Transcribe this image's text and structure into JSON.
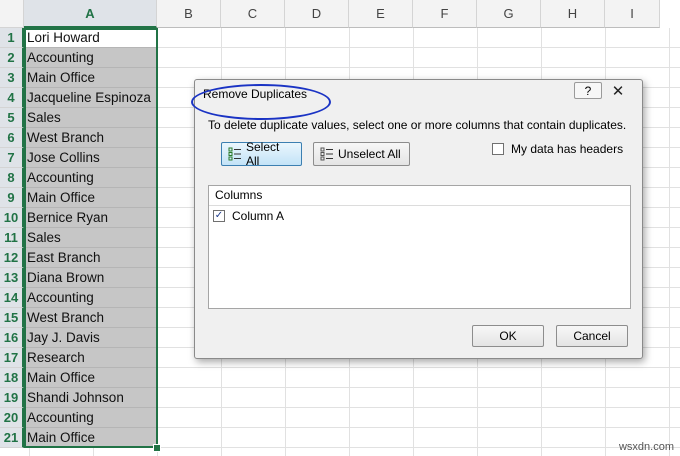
{
  "columns": [
    "A",
    "B",
    "C",
    "D",
    "E",
    "F",
    "G",
    "H",
    "I"
  ],
  "rows": [
    {
      "num": "1",
      "value": "Lori Howard"
    },
    {
      "num": "2",
      "value": "Accounting"
    },
    {
      "num": "3",
      "value": "Main Office"
    },
    {
      "num": "4",
      "value": "Jacqueline Espinoza"
    },
    {
      "num": "5",
      "value": "Sales"
    },
    {
      "num": "6",
      "value": "West Branch"
    },
    {
      "num": "7",
      "value": "Jose Collins"
    },
    {
      "num": "8",
      "value": "Accounting"
    },
    {
      "num": "9",
      "value": "Main Office"
    },
    {
      "num": "10",
      "value": "Bernice Ryan"
    },
    {
      "num": "11",
      "value": "Sales"
    },
    {
      "num": "12",
      "value": "East Branch"
    },
    {
      "num": "13",
      "value": "Diana Brown"
    },
    {
      "num": "14",
      "value": "Accounting"
    },
    {
      "num": "15",
      "value": "West Branch"
    },
    {
      "num": "16",
      "value": "Jay J. Davis"
    },
    {
      "num": "17",
      "value": "Research"
    },
    {
      "num": "18",
      "value": "Main Office"
    },
    {
      "num": "19",
      "value": "Shandi Johnson"
    },
    {
      "num": "20",
      "value": "Accounting"
    },
    {
      "num": "21",
      "value": "Main Office"
    }
  ],
  "dialog": {
    "title": "Remove Duplicates",
    "help": "?",
    "close": "✕",
    "instruction": "To delete duplicate values, select one or more columns that contain duplicates.",
    "select_all": "Select All",
    "unselect_all": "Unselect All",
    "headers_label": "My data has headers",
    "headers_checked": false,
    "columns_header": "Columns",
    "column_item": "Column A",
    "column_item_checked": true,
    "ok": "OK",
    "cancel": "Cancel"
  },
  "colors": {
    "accent": "#217346",
    "ellipse": "#1a33c4"
  },
  "watermark": "wsxdn.com"
}
